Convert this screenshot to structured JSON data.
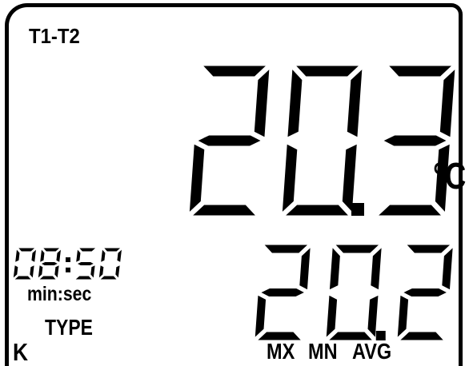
{
  "display": {
    "mode_label": "T1-T2",
    "primary_reading": "20.3",
    "primary_unit": "°C",
    "secondary_reading": "20.2",
    "timer_value": "08:50",
    "timer_unit": "min:sec",
    "thermocouple_type_label": "TYPE",
    "thermocouple_type_value": "K",
    "stat_labels": [
      "MX",
      "MN",
      "AVG"
    ]
  }
}
